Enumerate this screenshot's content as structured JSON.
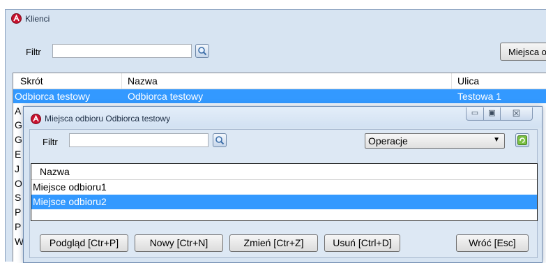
{
  "main_window": {
    "title": "Klienci",
    "filter_label": "Filtr",
    "filter_value": "",
    "right_button_label": "Miejsca o",
    "columns": [
      "Skrót",
      "Nazwa",
      "Ulica"
    ],
    "rows": [
      {
        "skrot": "Odbiorca testowy",
        "nazwa": "Odbiorca testowy",
        "ulica": "Testowa 1",
        "selected": true
      },
      {
        "skrot": "A",
        "nazwa": "",
        "ulica": ""
      },
      {
        "skrot": "G",
        "nazwa": "",
        "ulica": ""
      },
      {
        "skrot": "G",
        "nazwa": "",
        "ulica": ""
      },
      {
        "skrot": "E",
        "nazwa": "",
        "ulica": ""
      },
      {
        "skrot": "J",
        "nazwa": "",
        "ulica": ""
      },
      {
        "skrot": "O",
        "nazwa": "",
        "ulica": ""
      },
      {
        "skrot": "S",
        "nazwa": "",
        "ulica": ""
      },
      {
        "skrot": "P",
        "nazwa": "",
        "ulica": ""
      },
      {
        "skrot": "P",
        "nazwa": "",
        "ulica": ""
      },
      {
        "skrot": "W",
        "nazwa": "",
        "ulica": ""
      }
    ]
  },
  "dialog": {
    "title": "Miejsca odbioru Odbiorca testowy",
    "window_buttons": {
      "minimize": "▭",
      "maximize": "▣",
      "close": "☒"
    },
    "filter_label": "Filtr",
    "filter_value": "",
    "operations_select": "Operacje",
    "columns": [
      "Nazwa"
    ],
    "rows": [
      {
        "nazwa": "Miejsce odbioru1",
        "selected": false
      },
      {
        "nazwa": "Miejsce odbioru2",
        "selected": true
      }
    ],
    "buttons": {
      "preview": "Podgląd [Ctr+P]",
      "new": "Nowy [Ctr+N]",
      "edit": "Zmień [Ctr+Z]",
      "delete": "Usuń [Ctrl+D]",
      "back": "Wróć [Esc]"
    }
  },
  "colors": {
    "window_bg": "#d7e4f2",
    "selection": "#3399ff",
    "app_icon": "#c8102e"
  },
  "icons": [
    "app-logo-icon",
    "search-icon",
    "refresh-icon",
    "dropdown-arrow-icon"
  ]
}
